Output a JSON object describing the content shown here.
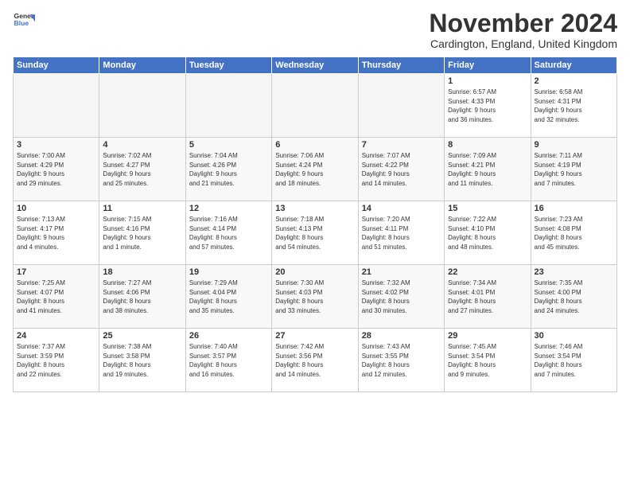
{
  "logo": {
    "line1": "General",
    "line2": "Blue"
  },
  "title": "November 2024",
  "subtitle": "Cardington, England, United Kingdom",
  "headers": [
    "Sunday",
    "Monday",
    "Tuesday",
    "Wednesday",
    "Thursday",
    "Friday",
    "Saturday"
  ],
  "weeks": [
    [
      {
        "day": "",
        "info": "",
        "empty": true
      },
      {
        "day": "",
        "info": "",
        "empty": true
      },
      {
        "day": "",
        "info": "",
        "empty": true
      },
      {
        "day": "",
        "info": "",
        "empty": true
      },
      {
        "day": "",
        "info": "",
        "empty": true
      },
      {
        "day": "1",
        "info": "Sunrise: 6:57 AM\nSunset: 4:33 PM\nDaylight: 9 hours\nand 36 minutes."
      },
      {
        "day": "2",
        "info": "Sunrise: 6:58 AM\nSunset: 4:31 PM\nDaylight: 9 hours\nand 32 minutes."
      }
    ],
    [
      {
        "day": "3",
        "info": "Sunrise: 7:00 AM\nSunset: 4:29 PM\nDaylight: 9 hours\nand 29 minutes."
      },
      {
        "day": "4",
        "info": "Sunrise: 7:02 AM\nSunset: 4:27 PM\nDaylight: 9 hours\nand 25 minutes."
      },
      {
        "day": "5",
        "info": "Sunrise: 7:04 AM\nSunset: 4:26 PM\nDaylight: 9 hours\nand 21 minutes."
      },
      {
        "day": "6",
        "info": "Sunrise: 7:06 AM\nSunset: 4:24 PM\nDaylight: 9 hours\nand 18 minutes."
      },
      {
        "day": "7",
        "info": "Sunrise: 7:07 AM\nSunset: 4:22 PM\nDaylight: 9 hours\nand 14 minutes."
      },
      {
        "day": "8",
        "info": "Sunrise: 7:09 AM\nSunset: 4:21 PM\nDaylight: 9 hours\nand 11 minutes."
      },
      {
        "day": "9",
        "info": "Sunrise: 7:11 AM\nSunset: 4:19 PM\nDaylight: 9 hours\nand 7 minutes."
      }
    ],
    [
      {
        "day": "10",
        "info": "Sunrise: 7:13 AM\nSunset: 4:17 PM\nDaylight: 9 hours\nand 4 minutes."
      },
      {
        "day": "11",
        "info": "Sunrise: 7:15 AM\nSunset: 4:16 PM\nDaylight: 9 hours\nand 1 minute."
      },
      {
        "day": "12",
        "info": "Sunrise: 7:16 AM\nSunset: 4:14 PM\nDaylight: 8 hours\nand 57 minutes."
      },
      {
        "day": "13",
        "info": "Sunrise: 7:18 AM\nSunset: 4:13 PM\nDaylight: 8 hours\nand 54 minutes."
      },
      {
        "day": "14",
        "info": "Sunrise: 7:20 AM\nSunset: 4:11 PM\nDaylight: 8 hours\nand 51 minutes."
      },
      {
        "day": "15",
        "info": "Sunrise: 7:22 AM\nSunset: 4:10 PM\nDaylight: 8 hours\nand 48 minutes."
      },
      {
        "day": "16",
        "info": "Sunrise: 7:23 AM\nSunset: 4:08 PM\nDaylight: 8 hours\nand 45 minutes."
      }
    ],
    [
      {
        "day": "17",
        "info": "Sunrise: 7:25 AM\nSunset: 4:07 PM\nDaylight: 8 hours\nand 41 minutes."
      },
      {
        "day": "18",
        "info": "Sunrise: 7:27 AM\nSunset: 4:06 PM\nDaylight: 8 hours\nand 38 minutes."
      },
      {
        "day": "19",
        "info": "Sunrise: 7:29 AM\nSunset: 4:04 PM\nDaylight: 8 hours\nand 35 minutes."
      },
      {
        "day": "20",
        "info": "Sunrise: 7:30 AM\nSunset: 4:03 PM\nDaylight: 8 hours\nand 33 minutes."
      },
      {
        "day": "21",
        "info": "Sunrise: 7:32 AM\nSunset: 4:02 PM\nDaylight: 8 hours\nand 30 minutes."
      },
      {
        "day": "22",
        "info": "Sunrise: 7:34 AM\nSunset: 4:01 PM\nDaylight: 8 hours\nand 27 minutes."
      },
      {
        "day": "23",
        "info": "Sunrise: 7:35 AM\nSunset: 4:00 PM\nDaylight: 8 hours\nand 24 minutes."
      }
    ],
    [
      {
        "day": "24",
        "info": "Sunrise: 7:37 AM\nSunset: 3:59 PM\nDaylight: 8 hours\nand 22 minutes."
      },
      {
        "day": "25",
        "info": "Sunrise: 7:38 AM\nSunset: 3:58 PM\nDaylight: 8 hours\nand 19 minutes."
      },
      {
        "day": "26",
        "info": "Sunrise: 7:40 AM\nSunset: 3:57 PM\nDaylight: 8 hours\nand 16 minutes."
      },
      {
        "day": "27",
        "info": "Sunrise: 7:42 AM\nSunset: 3:56 PM\nDaylight: 8 hours\nand 14 minutes."
      },
      {
        "day": "28",
        "info": "Sunrise: 7:43 AM\nSunset: 3:55 PM\nDaylight: 8 hours\nand 12 minutes."
      },
      {
        "day": "29",
        "info": "Sunrise: 7:45 AM\nSunset: 3:54 PM\nDaylight: 8 hours\nand 9 minutes."
      },
      {
        "day": "30",
        "info": "Sunrise: 7:46 AM\nSunset: 3:54 PM\nDaylight: 8 hours\nand 7 minutes."
      }
    ]
  ]
}
